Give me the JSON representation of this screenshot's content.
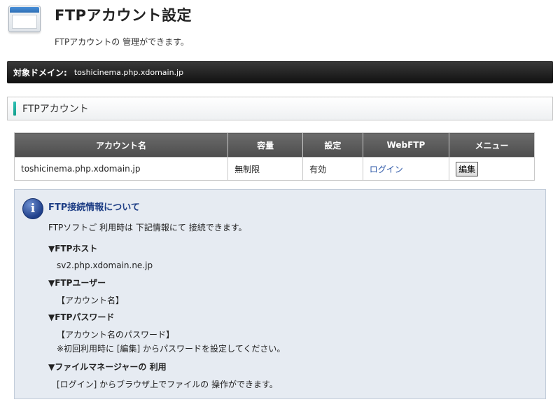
{
  "header": {
    "title": "FTPアカウント設定",
    "description": "FTPアカウントの 管理ができます。"
  },
  "domain_bar": {
    "label": "対象ドメイン:",
    "value": "toshicinema.php.xdomain.jp"
  },
  "section": {
    "title": "FTPアカウント"
  },
  "table": {
    "headers": [
      "アカウント名",
      "容量",
      "設定",
      "WebFTP",
      "メニュー"
    ],
    "rows": [
      {
        "account": "toshicinema.php.xdomain.jp",
        "capacity": "無制限",
        "status": "有効",
        "webftp": "ログイン",
        "menu": "編集"
      }
    ]
  },
  "info": {
    "title": "FTP接続情報について",
    "intro": "FTPソフトご 利用時は 下記情報にて 接続できます。",
    "items": [
      {
        "heading": "▼FTPホスト",
        "lines": [
          "sv2.php.xdomain.ne.jp"
        ]
      },
      {
        "heading": "▼FTPユーザー",
        "lines": [
          "【アカウント名】"
        ]
      },
      {
        "heading": "▼FTPパスワード",
        "lines": [
          "【アカウント名のパスワード】",
          "※初回利用時に [編集] からパスワードを設定してください。"
        ]
      },
      {
        "heading": "▼ファイルマネージャーの 利用",
        "lines": [
          "[ログイン] からブラウザ上でファイルの 操作ができます。"
        ]
      }
    ]
  }
}
